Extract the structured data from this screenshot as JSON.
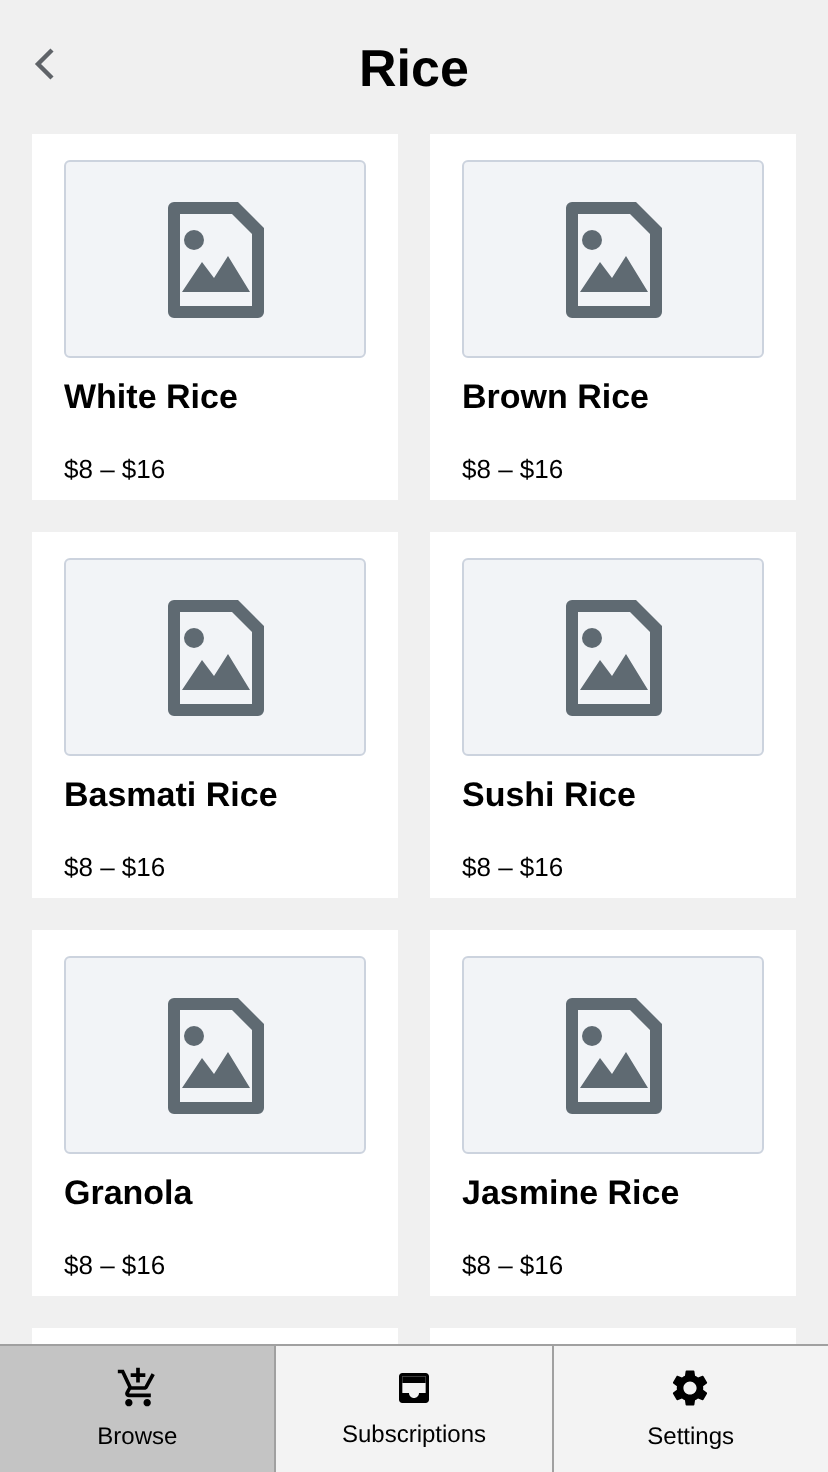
{
  "header": {
    "title": "Rice"
  },
  "products": [
    {
      "name": "White Rice",
      "price": "$8 – $16"
    },
    {
      "name": "Brown Rice",
      "price": "$8 – $16"
    },
    {
      "name": "Basmati Rice",
      "price": "$8 – $16"
    },
    {
      "name": "Sushi Rice",
      "price": "$8 – $16"
    },
    {
      "name": "Granola",
      "price": "$8 – $16"
    },
    {
      "name": "Jasmine Rice",
      "price": "$8 – $16"
    }
  ],
  "tabs": [
    {
      "label": "Browse",
      "kind": "cart",
      "selected": true
    },
    {
      "label": "Subscriptions",
      "kind": "inbox",
      "selected": false
    },
    {
      "label": "Settings",
      "kind": "gear",
      "selected": false
    }
  ]
}
